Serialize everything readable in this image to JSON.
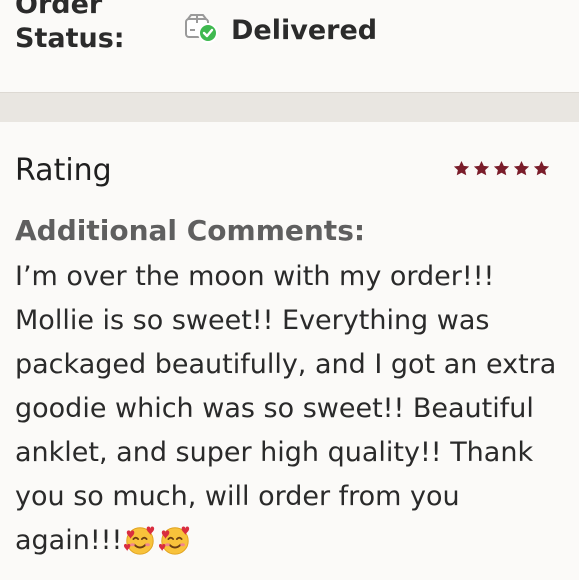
{
  "order_status": {
    "label_line1": "Order",
    "label_line2": "Status:",
    "value": "Delivered",
    "icon": "delivered-box-icon"
  },
  "review": {
    "rating_label": "Rating",
    "stars": 5,
    "star_color": "#7a1d2b",
    "comments_heading": "Additional Comments:",
    "comments_text": "I’m over the moon with my order!!! Mollie is so sweet!! Everything was packaged beautifully, and I got an extra goodie which was so sweet!! Beautiful anklet, and super high quality!! Thank you so much, will order from you again!!!",
    "comment_emojis": [
      "smiling-face-with-hearts",
      "smiling-face-with-hearts"
    ]
  }
}
